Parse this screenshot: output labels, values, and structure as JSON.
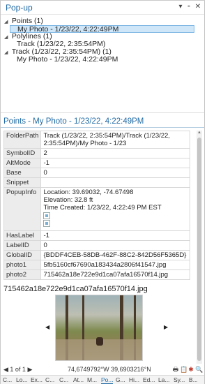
{
  "window": {
    "title": "Pop-up",
    "menu_icon": "▾",
    "float_icon": "▫",
    "close_icon": "✕"
  },
  "tree": [
    {
      "label": "Points  (1)",
      "toggle": "◢"
    },
    {
      "label": "My Photo - 1/23/22, 4:22:49PM",
      "selected": true
    },
    {
      "label": "Polylines  (1)",
      "toggle": "◢"
    },
    {
      "label": "Track (1/23/22, 2:35:54PM)"
    },
    {
      "label": "Track (1/23/22, 2:35:54PM)  (1)",
      "toggle": "◢"
    },
    {
      "label": "My Photo - 1/23/22, 4:22:49PM"
    }
  ],
  "details": {
    "title": "Points - My Photo - 1/23/22, 4:22:49PM",
    "rows": [
      {
        "key": "FolderPath",
        "value": "Track (1/23/22, 2:35:54PM)/Track (1/23/22, 2:35:54PM)/My Photo - 1/23"
      },
      {
        "key": "SymbolID",
        "value": "2"
      },
      {
        "key": "AltMode",
        "value": "-1"
      },
      {
        "key": "Base",
        "value": "0"
      },
      {
        "key": "Snippet",
        "value": ""
      },
      {
        "key": "PopupInfo",
        "value_lines": [
          "Location: 39.69032, -74.67498",
          "Elevation: 32.8 ft",
          "Time Created: 1/23/22, 4:22:49 PM EST"
        ]
      },
      {
        "key": "HasLabel",
        "value": "-1"
      },
      {
        "key": "LabelID",
        "value": "0"
      },
      {
        "key": "GlobalID",
        "value": "{BDDF4CEB-58DB-462F-88C2-842D56F5365D}"
      },
      {
        "key": "photo1",
        "value": "5fb5160cf67690a183434a2806f41547.jpg"
      },
      {
        "key": "photo2",
        "value": "715462a18e722e9d1ca07afa16570f14.jpg"
      }
    ],
    "media_caption": "715462a18e722e9d1ca07afa16570f14.jpg",
    "media_prev": "◀",
    "media_next": "▶"
  },
  "footer": {
    "nav": "◀ 1 of 1 ▶",
    "coordinates": "74,6749792°W 39,6903216°N",
    "icons": [
      "🖶",
      "📋",
      "✱",
      "🔍"
    ]
  },
  "bottom_tabs": [
    "C...",
    "Lo...",
    "Ex...",
    "C...",
    "C...",
    "At...",
    "M...",
    "Po...",
    "G...",
    "Hi...",
    "Ed...",
    "La...",
    "Sy...",
    "B..."
  ],
  "active_tab_index": 7,
  "colors": {
    "accent": "#1f6aa5",
    "selection": "#cfe6f8"
  }
}
